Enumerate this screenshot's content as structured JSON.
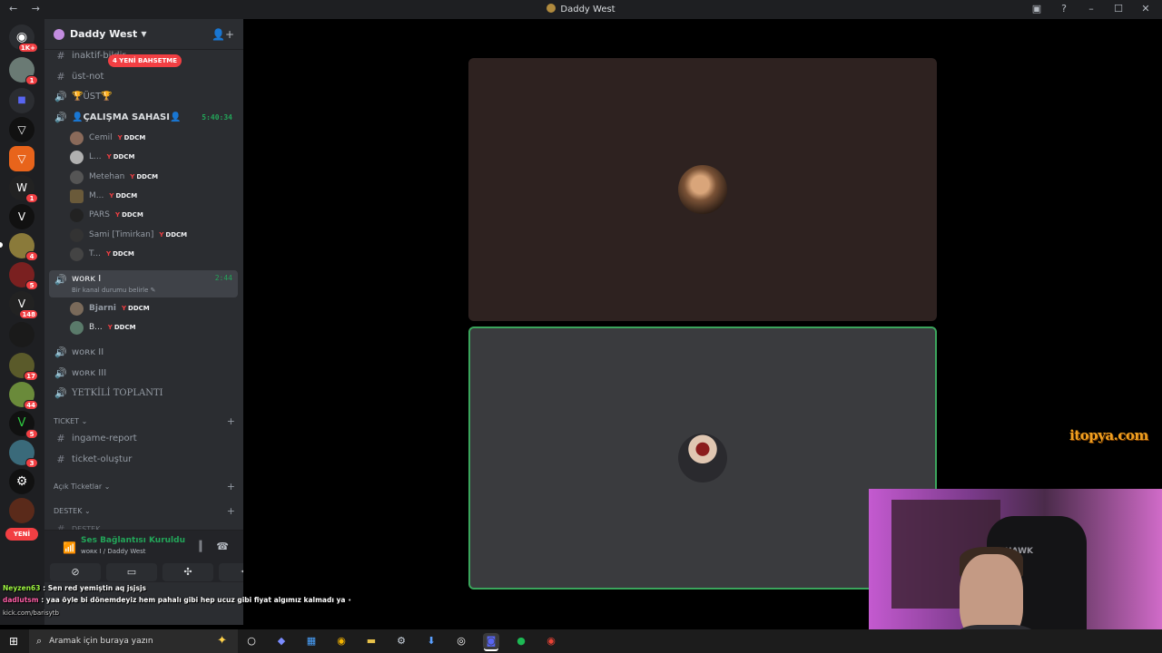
{
  "window": {
    "title": "Daddy West"
  },
  "rail": {
    "home_badge": "1K+",
    "badges": [
      "1",
      "1",
      "4",
      "5",
      "148",
      "17",
      "44",
      "5",
      "3"
    ],
    "new_label": "YENİ"
  },
  "server": {
    "name": "Daddy West"
  },
  "mention_pill": "4 YENİ BAHSETME",
  "channels": {
    "inaktif": "inaktif-bildir",
    "ust_not": "üst-not",
    "ust": "🏆ÜST🏆",
    "calisma": "👤ÇALIŞMA SAHASI👤",
    "calisma_timer": "5:40:34",
    "work1": "ᴡᴏʀᴋ I",
    "work1_timer": "2:44",
    "work1_status": "Bir kanal durumu belirle",
    "work2": "ᴡᴏʀᴋ II",
    "work3": "ᴡᴏʀᴋ III",
    "yetkili": "YETKİLİ TOPLANTI",
    "ingame": "ingame-report",
    "ticket_olustur": "ticket-oluştur",
    "destek_partial": "DESTEK"
  },
  "categories": {
    "ticket": "TICKET",
    "acik": "Açık Ticketlar",
    "destek": "DESTEK"
  },
  "calisma_users": [
    {
      "name": "Cemil",
      "tag": "DDCM"
    },
    {
      "name": "L...",
      "tag": "DDCM"
    },
    {
      "name": "Metehan",
      "tag": "DDCM"
    },
    {
      "name": "M...",
      "tag": "DDCM"
    },
    {
      "name": "PARS",
      "tag": "DDCM"
    },
    {
      "name": "Sami [Timirkan]",
      "tag": "DDCM"
    },
    {
      "name": "T...",
      "tag": "DDCM"
    }
  ],
  "work1_users": [
    {
      "name": "Bjarni",
      "tag": "DDCM"
    },
    {
      "name": "B...",
      "tag": "DDCM"
    }
  ],
  "voice_panel": {
    "title": "Ses Bağlantısı Kuruldu",
    "subtitle": "ᴡᴏʀᴋ I / Daddy West"
  },
  "chat": [
    {
      "user": "Neyzen63",
      "text": " : Sen red yemiştin aq jsjsjs"
    },
    {
      "user": "dadlutsm",
      "text": " : yaa öyle bi dönemdeyiz hem pahalı gibi hep ucuz gibi fiyat algımız kalmadı ya"
    }
  ],
  "chat_source": "kick.com/barisytb",
  "watermark": "itopya.com",
  "webcam_chair": "HAWK",
  "taskbar": {
    "search_placeholder": "Aramak için buraya yazın"
  },
  "colors": {
    "accent_green": "#23a559",
    "mention_red": "#f23f43",
    "sidebar": "#2b2d31"
  }
}
